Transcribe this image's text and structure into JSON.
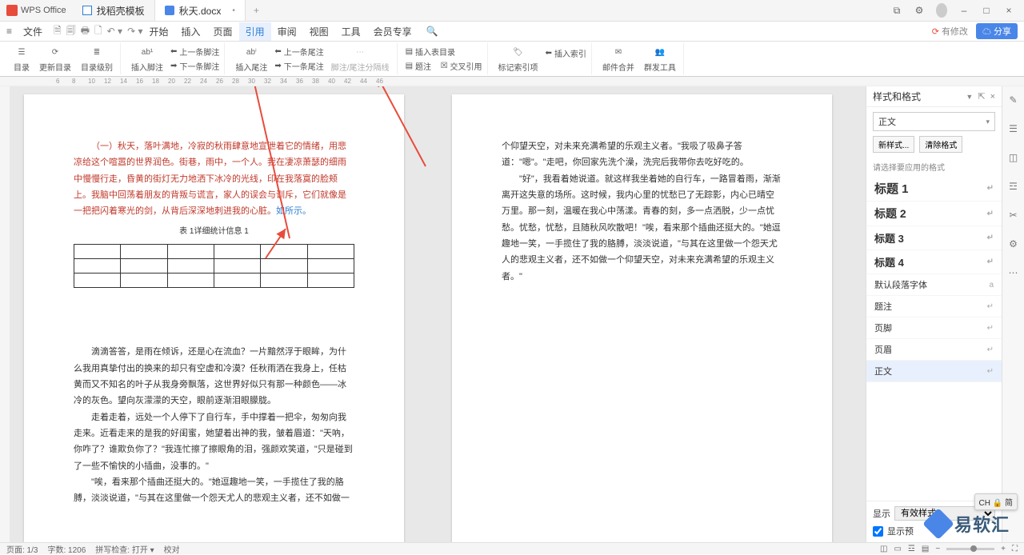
{
  "titlebar": {
    "logo": "WPS Office",
    "tabs": [
      {
        "label": "找稻壳模板",
        "type": "doc"
      },
      {
        "label": "秋天.docx",
        "type": "word",
        "active": true
      }
    ]
  },
  "menubar": {
    "file": "文件",
    "items": [
      "开始",
      "插入",
      "页面",
      "引用",
      "审阅",
      "视图",
      "工具",
      "会员专享"
    ],
    "active_index": 3,
    "unsaved": "有修改",
    "share": "分享"
  },
  "ribbon": {
    "toc": "目录",
    "update_toc": "更新目录",
    "toc_level": "目录级别",
    "insert_footnote": "插入脚注",
    "prev_footnote": "上一条脚注",
    "next_footnote": "下一条脚注",
    "insert_endnote": "插入尾注",
    "prev_endnote": "上一条尾注",
    "next_endnote": "下一条尾注",
    "footnote_sep": "脚注/尾注分隔线",
    "insert_caption": "插入表目录",
    "caption": "题注",
    "cross_ref": "交叉引用",
    "mark_index": "标记索引项",
    "insert_index": "插入索引",
    "mail_merge": "邮件合并",
    "mass_tools": "群发工具"
  },
  "ruler": [
    "6",
    "8",
    "10",
    "12",
    "14",
    "16",
    "18",
    "20",
    "22",
    "24",
    "26",
    "28",
    "30",
    "32",
    "34",
    "36",
    "38",
    "40",
    "42",
    "44",
    "46"
  ],
  "document": {
    "page1": {
      "para1": "（一）秋天，落叶满地，冷寂的秋雨肆意地宣泄着它的情绪，用悲凉给这个喧嚣的世界润色。街巷，雨中，一个人。我在凄凉萧瑟的细雨中慢慢行走，昏黄的街灯无力地洒下冰冷的光线，印在我落寞的脸颊上。我脑中回荡着朋友的背叛与谎言，家人的误会与训斥，它们就像是一把把闪着寒光的剑，从背后深深地刺进我的心脏。",
      "ref_text": "如所示。",
      "caption": "表 1详细统计信息 1",
      "para2": "滴滴答答，是雨在倾诉，还是心在流血？一片黯然浮于眼眸，为什么我用真挚付出的换来的却只有空虚和冷漠？任秋雨洒在我身上，任枯黄而又不知名的叶子从我身旁飘落，这世界好似只有那一种颜色——冰冷的灰色。望向灰濛濛的天空，眼前逐渐泪眼朦胧。",
      "para3": "走着走着，远处一个人停下了自行车，手中撑着一把伞，匆匆向我走来。近看走来的是我的好闺蜜，她望着出神的我，皱着眉道：\"天吶，你咋了？谁欺负你了？\"我连忙擦了擦眼角的泪，强颜欢笑道，\"只是碰到了一些不愉快的小插曲，没事的。\"",
      "para4": "\"唉，看来那个插曲还挺大的。\"她逗趣地一笑，一手揽住了我的胳膊，淡淡说道，\"与其在这里做一个怨天尤人的悲观主义者，还不如做一"
    },
    "page2": {
      "para1": "个仰望天空，对未来充满希望的乐观主义者。\"我吸了吸鼻子答道：\"嗯\"。\"走吧，你回家先洗个澡，洗完后我带你去吃好吃的。",
      "para2": "\"好\"，我看着她说道。就这样我坐着她的自行车，一路冒着雨，渐渐离开这失意的场所。这时候，我内心里的忧愁已了无踪影，内心已晴空万里。那一刻，温暖在我心中荡漾。青春的刻，多一点洒脱，少一点忧愁。忧愁，忧愁，且随秋风吹散吧！\"唉，看来那个插曲还挺大的。\"她逗趣地一笑，一手揽住了我的胳膊，淡淡说道，\"与其在这里做一个怨天尤人的悲观主义者，还不如做一个仰望天空，对未来充满希望的乐观主义者。\""
    }
  },
  "styles_panel": {
    "title": "样式和格式",
    "current": "正文",
    "new_style": "新样式...",
    "clear_format": "清除格式",
    "hint": "请选择要应用的格式",
    "items": [
      {
        "label": "标题 1",
        "class": "h1"
      },
      {
        "label": "标题 2",
        "class": "h2"
      },
      {
        "label": "标题 3",
        "class": "h3"
      },
      {
        "label": "标题 4",
        "class": "h4"
      },
      {
        "label": "默认段落字体",
        "class": "normal"
      },
      {
        "label": "题注",
        "class": "normal"
      },
      {
        "label": "页脚",
        "class": "normal"
      },
      {
        "label": "页眉",
        "class": "normal"
      },
      {
        "label": "正文",
        "class": "normal",
        "selected": true
      }
    ],
    "display": "显示",
    "display_value": "有效样式",
    "show_preview": "显示预"
  },
  "statusbar": {
    "page": "页面: 1/3",
    "words": "字数: 1206",
    "spell": "拼写检查: 打开",
    "proof": "校对"
  },
  "ime": "CH 🔒 简",
  "watermark": "易软汇"
}
